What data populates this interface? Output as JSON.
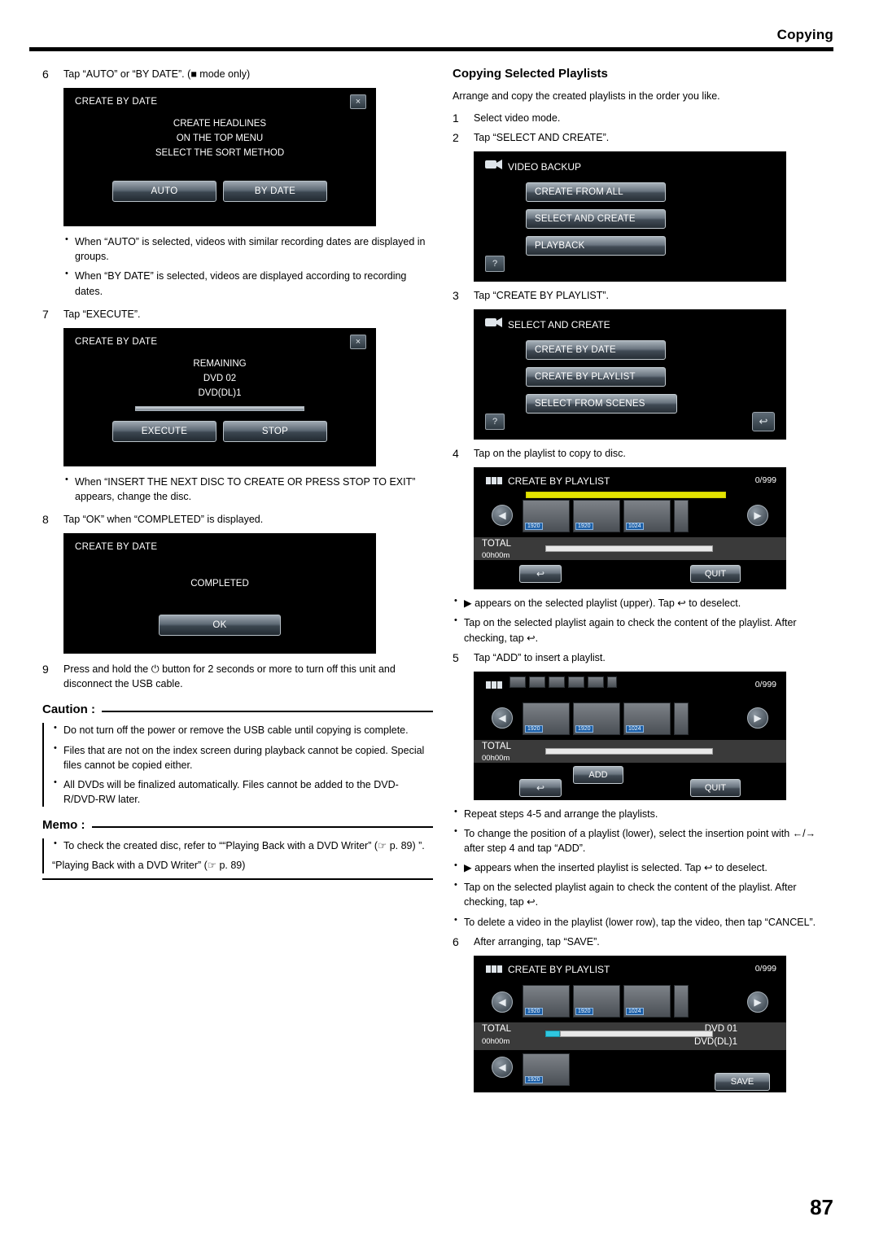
{
  "header": {
    "title": "Copying"
  },
  "page_number": "87",
  "left": {
    "step6": {
      "num": "6",
      "text": "Tap “AUTO” or “BY DATE”. (■ mode only)"
    },
    "screen6": {
      "title": "CREATE BY DATE",
      "close_icon": "×",
      "lines": [
        "CREATE HEADLINES",
        "ON THE TOP MENU",
        "SELECT THE SORT METHOD"
      ],
      "buttons": [
        "AUTO",
        "BY DATE"
      ]
    },
    "bullets6": [
      "When “AUTO” is selected, videos with similar recording dates are displayed in groups.",
      "When “BY DATE” is selected, videos are displayed according to recording dates."
    ],
    "step7": {
      "num": "7",
      "text": "Tap “EXECUTE”."
    },
    "screen7": {
      "title": "CREATE BY DATE",
      "close_icon": "×",
      "lines": [
        "REMAINING",
        "DVD   02",
        "DVD(DL)1"
      ],
      "buttons": [
        "EXECUTE",
        "STOP"
      ]
    },
    "bullet7": "When “INSERT THE NEXT DISC TO CREATE OR PRESS STOP TO EXIT” appears, change the disc.",
    "step8": {
      "num": "8",
      "text": "Tap “OK” when “COMPLETED” is displayed."
    },
    "screen8": {
      "title": "CREATE BY DATE",
      "lines": [
        "COMPLETED"
      ],
      "buttons": [
        "OK"
      ]
    },
    "step9": {
      "num": "9",
      "text": "Press and hold the ⏻ button for 2 seconds or more to turn off this unit and disconnect the USB cable."
    },
    "caution": {
      "label": "Caution :",
      "items": [
        "Do not turn off the power or remove the USB cable until copying is complete.",
        "Files that are not on the index screen during playback cannot be copied. Special files cannot be copied either.",
        "All DVDs will be finalized automatically. Files cannot be added to the DVD-R/DVD-RW later."
      ]
    },
    "memo": {
      "label": "Memo :",
      "items": [
        "To check the created disc, refer to ““Playing Back with a DVD Writer” (☞ p. 89) ”."
      ],
      "link": "“Playing Back with a DVD Writer” (☞ p. 89)"
    }
  },
  "right": {
    "section_title": "Copying Selected Playlists",
    "intro": "Arrange and copy the created playlists in the order you like.",
    "step1": {
      "num": "1",
      "text": "Select video mode."
    },
    "step2": {
      "num": "2",
      "text": "Tap “SELECT AND CREATE”."
    },
    "screen2": {
      "title": "VIDEO BACKUP",
      "buttons": [
        "CREATE FROM ALL",
        "SELECT AND CREATE",
        "PLAYBACK"
      ],
      "help_icon": "?"
    },
    "step3": {
      "num": "3",
      "text": "Tap “CREATE BY PLAYLIST”."
    },
    "screen3": {
      "title": "SELECT AND CREATE",
      "buttons": [
        "CREATE BY DATE",
        "CREATE BY PLAYLIST",
        "SELECT FROM SCENES"
      ],
      "help_icon": "?",
      "back_icon": "↩"
    },
    "step4": {
      "num": "4",
      "text": "Tap on the playlist to copy to disc."
    },
    "screen4": {
      "title": "CREATE BY PLAYLIST",
      "count": "0/999",
      "total_label": "TOTAL",
      "total_time": "00h00m",
      "thumb_res": [
        "1920",
        "1920",
        "1024"
      ],
      "buttons": [
        "QUIT"
      ],
      "back_icon": "↩"
    },
    "bullets4": [
      "▶ appears on the selected playlist (upper). Tap ↩ to deselect.",
      "Tap on the selected playlist again to check the content of the playlist. After checking, tap ↩."
    ],
    "step5": {
      "num": "5",
      "text": "Tap “ADD” to insert a playlist."
    },
    "screen5": {
      "count": "0/999",
      "total_label": "TOTAL",
      "total_time": "00h00m",
      "thumb_res": [
        "1920",
        "1920",
        "1024"
      ],
      "buttons": [
        "ADD",
        "QUIT"
      ],
      "back_icon": "↩"
    },
    "bullets5": [
      "Repeat steps 4-5 and arrange the playlists.",
      "To change the position of a playlist (lower), select the insertion point with ←/→ after step 4 and tap “ADD”.",
      "▶ appears when the inserted playlist is selected. Tap ↩ to deselect.",
      "Tap on the selected playlist again to check the content of the playlist. After checking, tap ↩.",
      "To delete a video in the playlist (lower row), tap the video, then tap “CANCEL”."
    ],
    "step6": {
      "num": "6",
      "text": "After arranging, tap “SAVE”."
    },
    "screen6": {
      "title": "CREATE BY PLAYLIST",
      "count": "0/999",
      "total_label": "TOTAL",
      "total_time": "00h00m",
      "dvd_line1": "DVD   01",
      "dvd_line2": "DVD(DL)1",
      "thumb_res": [
        "1920",
        "1920",
        "1024",
        "1920"
      ],
      "buttons": [
        "SAVE"
      ],
      "back_icon": "↩"
    }
  }
}
